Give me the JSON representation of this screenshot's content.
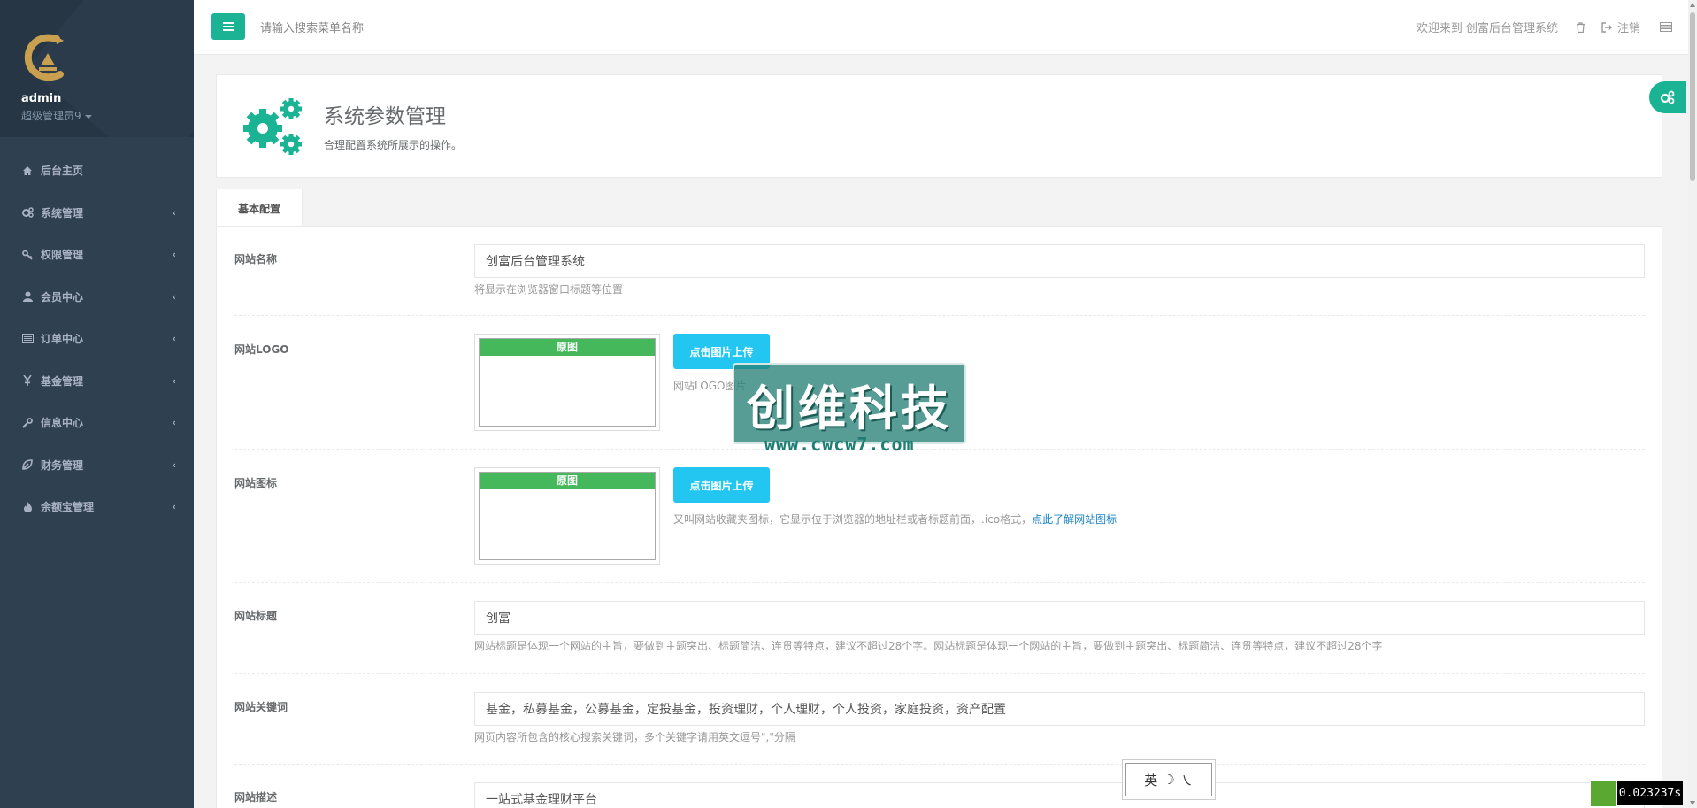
{
  "sidebar": {
    "user": {
      "name": "admin",
      "role": "超级管理员9"
    },
    "items": [
      {
        "label": "后台主页",
        "icon": "home-icon",
        "has_children": false
      },
      {
        "label": "系统管理",
        "icon": "cogs-icon",
        "has_children": true
      },
      {
        "label": "权限管理",
        "icon": "key-icon",
        "has_children": true
      },
      {
        "label": "会员中心",
        "icon": "user-icon",
        "has_children": true
      },
      {
        "label": "订单中心",
        "icon": "list-icon",
        "has_children": true
      },
      {
        "label": "基金管理",
        "icon": "yen-icon",
        "has_children": true
      },
      {
        "label": "信息中心",
        "icon": "wrench-icon",
        "has_children": true
      },
      {
        "label": "财务管理",
        "icon": "leaf-icon",
        "has_children": true
      },
      {
        "label": "余额宝管理",
        "icon": "fire-icon",
        "has_children": true
      }
    ],
    "arrow": "‹"
  },
  "topbar": {
    "search_placeholder": "请输入搜索菜单名称",
    "welcome": "欢迎来到 创富后台管理系统",
    "logout": "注销"
  },
  "page": {
    "title": "系统参数管理",
    "description": "合理配置系统所展示的操作。"
  },
  "tabs": [
    {
      "label": "基本配置",
      "active": true
    }
  ],
  "form": {
    "site_name": {
      "label": "网站名称",
      "value": "创富后台管理系统",
      "help": "将显示在浏览器窗口标题等位置"
    },
    "site_logo": {
      "label": "网站LOGO",
      "image_caption": "原图",
      "upload_label": "点击图片上传",
      "help": "网站LOGO图片"
    },
    "site_icon": {
      "label": "网站图标",
      "image_caption": "原图",
      "upload_label": "点击图片上传",
      "help": "又叫网站收藏夹图标，它显示位于浏览器的地址栏或者标题前面，.ico格式，",
      "help_link": "点此了解网站图标"
    },
    "site_title": {
      "label": "网站标题",
      "value": "创富",
      "help": "网站标题是体现一个网站的主旨，要做到主题突出、标题简洁、连贯等特点，建议不超过28个字。网站标题是体现一个网站的主旨，要做到主题突出、标题简洁、连贯等特点，建议不超过28个字"
    },
    "site_keywords": {
      "label": "网站关键词",
      "value": "基金，私募基金，公募基金，定投基金，投资理财，个人理财，个人投资，家庭投资，资产配置",
      "help": "网页内容所包含的核心搜索关键词，多个关键字请用英文逗号\",\"分隔"
    },
    "site_desc": {
      "label": "网站描述",
      "value": "一站式基金理财平台"
    }
  },
  "watermark": {
    "title": "创维科技",
    "url": "www.cwcw7.com"
  },
  "ime": {
    "chars": [
      "英",
      "☽",
      "㇏"
    ]
  },
  "timing": "0.023237s",
  "colors": {
    "sidebar_bg": "#2f4050",
    "primary": "#1ab394",
    "info": "#23c6f0",
    "success_bar": "#44b85a"
  }
}
